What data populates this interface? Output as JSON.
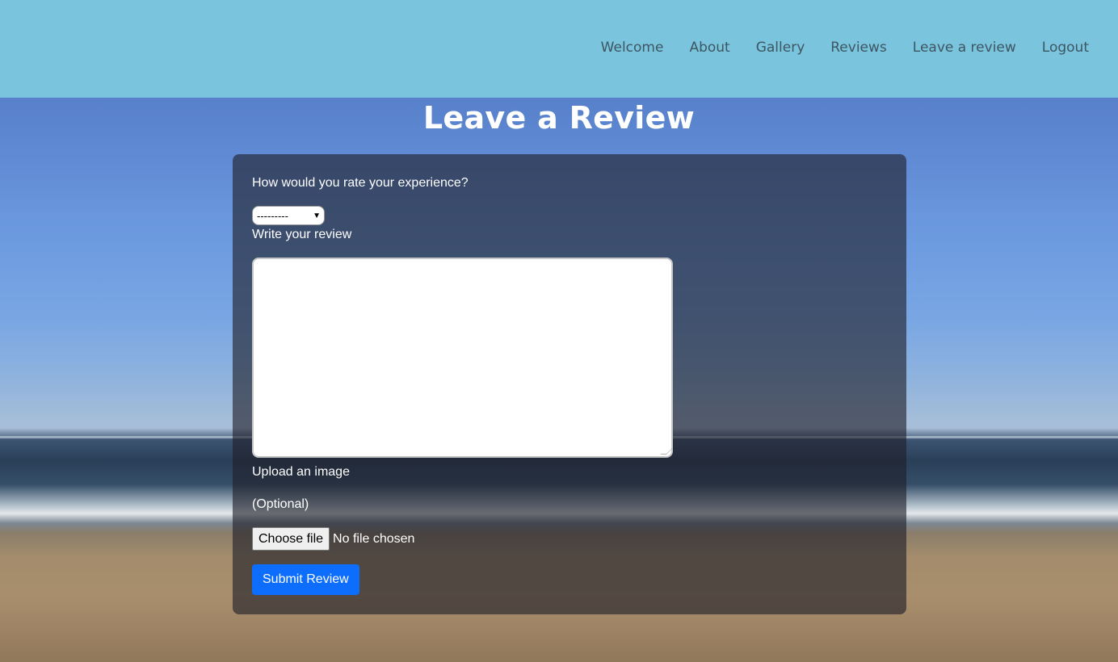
{
  "nav": {
    "items": [
      "Welcome",
      "About",
      "Gallery",
      "Reviews",
      "Leave a review",
      "Logout"
    ]
  },
  "page": {
    "title": "Leave a Review"
  },
  "form": {
    "rating_label": "How would you rate your experience?",
    "rating_selected": "---------",
    "review_label": "Write your review",
    "review_value": "",
    "upload_label": "Upload an image",
    "optional_label": "(Optional)",
    "choose_file_label": "Choose file",
    "file_status": "No file chosen",
    "submit_label": "Submit Review"
  },
  "colors": {
    "navbar": "#7ac4de",
    "nav_text": "#3d5661",
    "submit": "#0d6efd"
  }
}
